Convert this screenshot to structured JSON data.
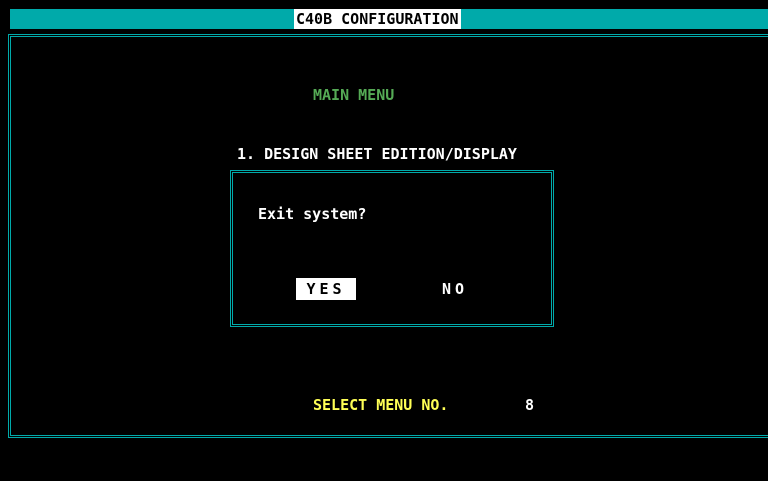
{
  "window": {
    "title": "C40B CONFIGURATION"
  },
  "main": {
    "heading": "MAIN MENU",
    "menu_item_1": "1. DESIGN SHEET EDITION/DISPLAY",
    "select_label": "SELECT MENU NO.",
    "select_value": "8"
  },
  "dialog": {
    "message": "Exit system?",
    "yes_label": "YES",
    "no_label": "NO",
    "selected": "YES"
  },
  "colors": {
    "accent": "#00aaaa",
    "heading": "#55aa55",
    "prompt": "#ffff55",
    "background": "#000000",
    "text": "#ffffff"
  }
}
